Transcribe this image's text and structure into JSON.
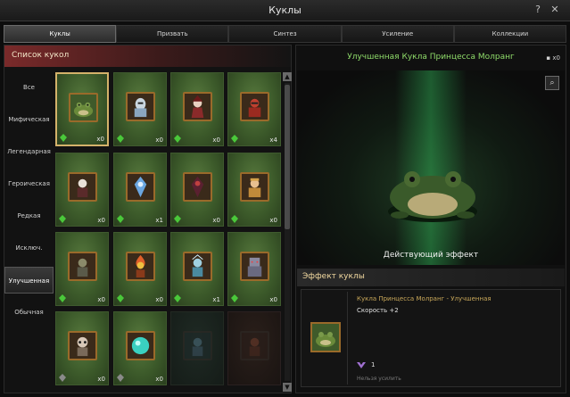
{
  "window": {
    "title": "Куклы",
    "help": "?",
    "close": "✕"
  },
  "tabs": [
    "Куклы",
    "Призвать",
    "Синтез",
    "Усиление",
    "Коллекции"
  ],
  "list": {
    "title": "Список кукол",
    "categories": [
      "Все",
      "Мифическая",
      "Легендарная",
      "Героическая",
      "Редкая",
      "Исключ.",
      "Улучшенная",
      "Обычная"
    ],
    "active_category": "Улучшенная",
    "slots": [
      {
        "count": "x0",
        "icon": "frog-doll-icon"
      },
      {
        "count": "x0",
        "icon": "knight-doll-icon"
      },
      {
        "count": "x0",
        "icon": "mage-doll-icon"
      },
      {
        "count": "x4",
        "icon": "red-warrior-doll-icon"
      },
      {
        "count": "x0",
        "icon": "pale-doll-icon"
      },
      {
        "count": "x1",
        "icon": "blue-armor-doll-icon"
      },
      {
        "count": "x0",
        "icon": "dark-armor-doll-icon"
      },
      {
        "count": "x0",
        "icon": "golden-doll-icon"
      },
      {
        "count": "x0",
        "icon": "stone-doll-icon"
      },
      {
        "count": "x0",
        "icon": "fire-doll-icon"
      },
      {
        "count": "x1",
        "icon": "ice-doll-icon"
      },
      {
        "count": "x0",
        "icon": "golem-doll-icon"
      },
      {
        "count": "x0",
        "icon": "skull-doll-icon"
      },
      {
        "count": "x0",
        "icon": "orb-doll-icon"
      },
      {
        "count": "",
        "icon": "locked-doll-icon"
      },
      {
        "count": "",
        "icon": "locked-doll-icon"
      }
    ]
  },
  "detail": {
    "title": "Улучшенная Кукла Принцесса Молранг",
    "count": "x0",
    "active_effect": "Действующий эффект",
    "effect_header": "Эффект куклы",
    "effect_name": "Кукла Принцесса Молранг - Улучшенная",
    "effect_stat": "Скорость +2",
    "level": "1",
    "note": "Нельзя усилить"
  }
}
